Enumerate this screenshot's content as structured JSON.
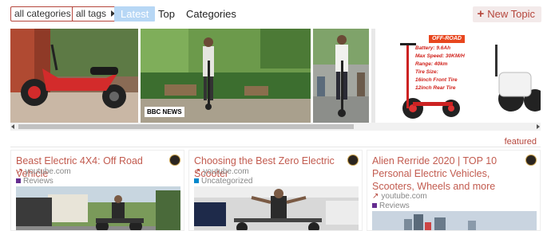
{
  "nav": {
    "categories_filter": "all categories",
    "tags_filter": "all tags",
    "tabs": [
      {
        "label": "Latest",
        "active": true
      },
      {
        "label": "Top",
        "active": false
      },
      {
        "label": "Categories",
        "active": false
      }
    ],
    "new_topic_label": "New Topic"
  },
  "featured": {
    "label": "featured",
    "slides": [
      {
        "icon": "red-electric-chopper-photo"
      },
      {
        "icon": "man-riding-scooter-park-photo",
        "badge": "BBC NEWS"
      },
      {
        "icon": "man-on-scooter-street-photo"
      },
      {
        "icon": "scooter-spec-ad-photo",
        "badge": "OFF-ROAD",
        "specs": [
          "Battery: 9.6Ah",
          "Max Speed: 30KM/H",
          "Range: 40km",
          "Tire Size:",
          "16inch Front Tire",
          "12inch Rear Tire"
        ]
      }
    ]
  },
  "topics": [
    {
      "title": "Beast Electric 4X4: Off Road Vehicle",
      "source": "youtube.com",
      "category": "Reviews",
      "category_color": "#652d90"
    },
    {
      "title": "Choosing the Best Zero Electric Scooter",
      "source": "youtube.com",
      "category": "Uncategorized",
      "category_color": "#0088cc"
    },
    {
      "title": "Alien Rerride 2020 | TOP 10 Personal Electric Vehicles, Scooters, Wheels and more",
      "source": "youtube.com",
      "category": "Reviews",
      "category_color": "#652d90"
    }
  ],
  "colors": {
    "accent": "#b5463c",
    "active_tab": "#b7d7f5",
    "title": "#c25b4f"
  }
}
